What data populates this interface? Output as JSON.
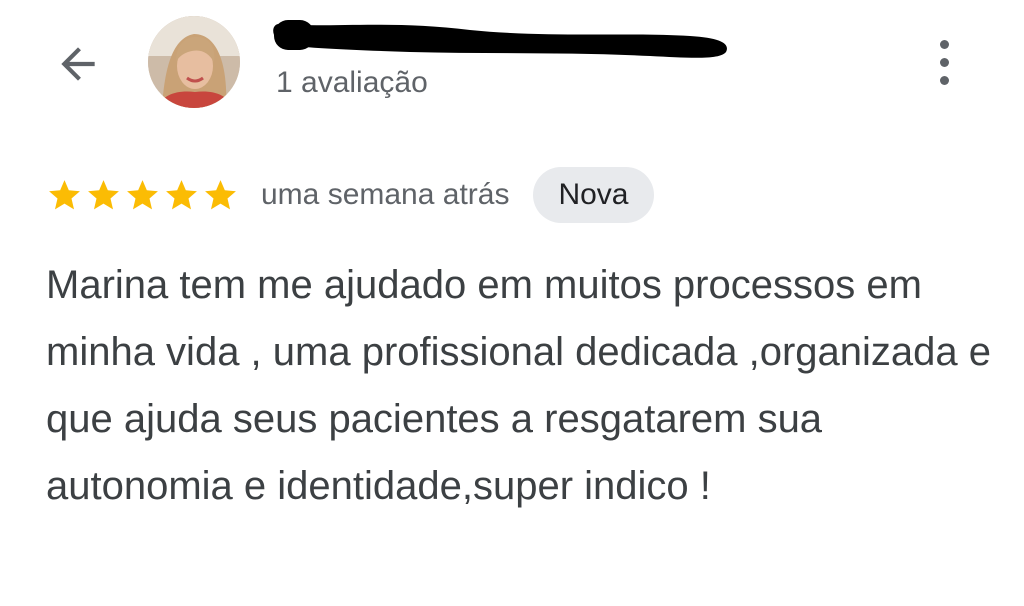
{
  "header": {
    "back_icon": "arrow-back-icon",
    "reviewer_name": "",
    "review_count": "1 avaliação",
    "more_icon": "more-vert-icon"
  },
  "review": {
    "rating": 5,
    "rating_max": 5,
    "star_color": "#fbbc04",
    "date": "uma semana atrás",
    "badge": "Nova",
    "text": "Marina tem me ajudado em muitos processos em minha vida , uma profissional dedicada ,organizada e que ajuda seus pacientes a resgatarem sua autonomia e identidade,super indico !"
  }
}
